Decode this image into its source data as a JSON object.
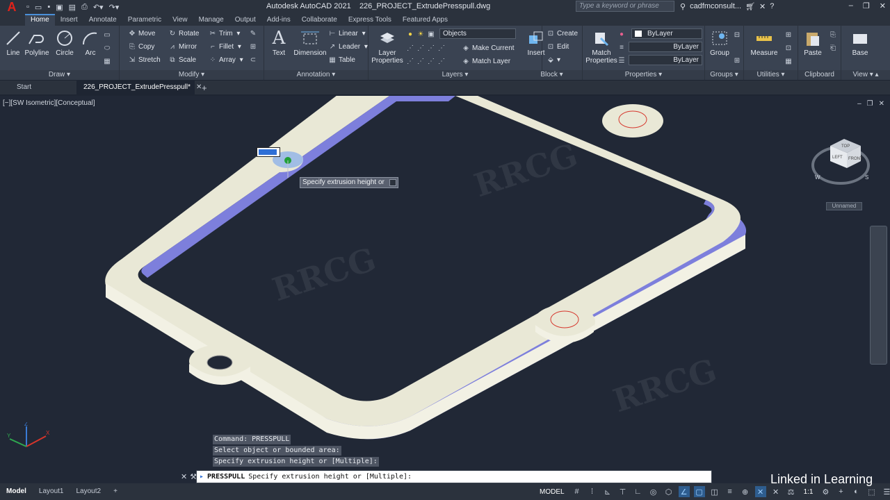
{
  "app": {
    "logo": "A",
    "title": "Autodesk AutoCAD 2021",
    "filename": "226_PROJECT_ExtrudePresspull.dwg",
    "search_placeholder": "Type a keyword or phrase",
    "user": "cadfmconsult..."
  },
  "ribbon_tabs": [
    "Home",
    "Insert",
    "Annotate",
    "Parametric",
    "View",
    "Manage",
    "Output",
    "Add-ins",
    "Collaborate",
    "Express Tools",
    "Featured Apps"
  ],
  "ribbon": {
    "draw": {
      "title": "Draw",
      "line": "Line",
      "polyline": "Polyline",
      "circle": "Circle",
      "arc": "Arc"
    },
    "modify": {
      "title": "Modify",
      "move": "Move",
      "rotate": "Rotate",
      "trim": "Trim",
      "copy": "Copy",
      "mirror": "Mirror",
      "fillet": "Fillet",
      "stretch": "Stretch",
      "scale": "Scale",
      "array": "Array"
    },
    "annotation": {
      "title": "Annotation",
      "text": "Text",
      "dimension": "Dimension",
      "linear": "Linear",
      "leader": "Leader",
      "table": "Table"
    },
    "layers": {
      "title": "Layers",
      "layer_properties": "Layer Properties",
      "objects": "Objects",
      "make_current": "Make Current",
      "match_layer": "Match Layer"
    },
    "block": {
      "title": "Block",
      "insert": "Insert",
      "create": "Create",
      "edit": "Edit"
    },
    "properties": {
      "title": "Properties",
      "match_properties": "Match Properties",
      "color": "ByLayer",
      "linetype": "ByLayer",
      "lineweight": "ByLayer"
    },
    "groups": {
      "title": "Groups",
      "group": "Group"
    },
    "utilities": {
      "title": "Utilities",
      "measure": "Measure"
    },
    "clipboard": {
      "title": "Clipboard",
      "paste": "Paste"
    },
    "view": {
      "title": "View",
      "base": "Base"
    }
  },
  "file_tabs": {
    "start": "Start",
    "active": "226_PROJECT_ExtrudePresspull*"
  },
  "viewport": {
    "label": "[−][SW Isometric][Conceptual]",
    "unnamed": "Unnamed",
    "tooltip": "Specify extrusion height or",
    "viewcube": {
      "top": "TOP",
      "left": "LEFT",
      "front": "FRONT",
      "w": "W",
      "s": "S"
    }
  },
  "command_history": [
    "Command: PRESSPULL",
    "Select object or bounded area:",
    "Specify extrusion height or [Multiple]:"
  ],
  "command_line": {
    "name": "PRESSPULL",
    "prompt": "Specify extrusion height or [Multiple]:"
  },
  "status": {
    "layouts": [
      "Model",
      "Layout1",
      "Layout2"
    ],
    "model_label": "MODEL",
    "scale": "1:1"
  },
  "branding": "Linked in Learning",
  "colors": {
    "accent": "#4a90d9",
    "part_top": "#e9e8d6",
    "part_side": "#7d7fdc",
    "hole_outline": "#d6352b"
  }
}
